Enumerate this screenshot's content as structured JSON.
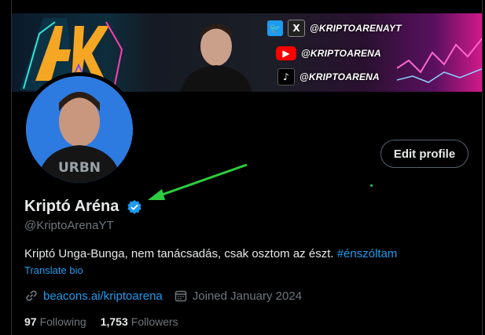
{
  "banner": {
    "logo_text": "4K",
    "socials": [
      {
        "icon": "twitter-x-icon",
        "handle": "@KRIPTOARENAYT",
        "color": "#1d9bf0"
      },
      {
        "icon": "youtube-icon",
        "handle": "@KRIPTOARENA",
        "color": "#ff0000"
      },
      {
        "icon": "tiktok-icon",
        "handle": "@KRIPTOARENA",
        "color": "#000000"
      }
    ]
  },
  "avatar": {
    "shirt_text": "URBN"
  },
  "actions": {
    "edit_profile": "Edit profile"
  },
  "profile": {
    "name": "Kriptó Aréna",
    "handle": "@KriptoArenaYT",
    "bio_text": "Kriptó Unga-Bunga, nem tanácsadás, csak osztom az észt.",
    "bio_hashtag": "#énszóltam",
    "translate": "Translate bio",
    "link": "beacons.ai/kriptoarena",
    "joined": "Joined January 2024"
  },
  "stats": {
    "following_count": "97",
    "following_label": "Following",
    "followers_count": "1,753",
    "followers_label": "Followers"
  },
  "colors": {
    "accent": "#1d9bf0",
    "annotation_arrow": "#2ecc40",
    "verified": "#1d9bf0"
  }
}
